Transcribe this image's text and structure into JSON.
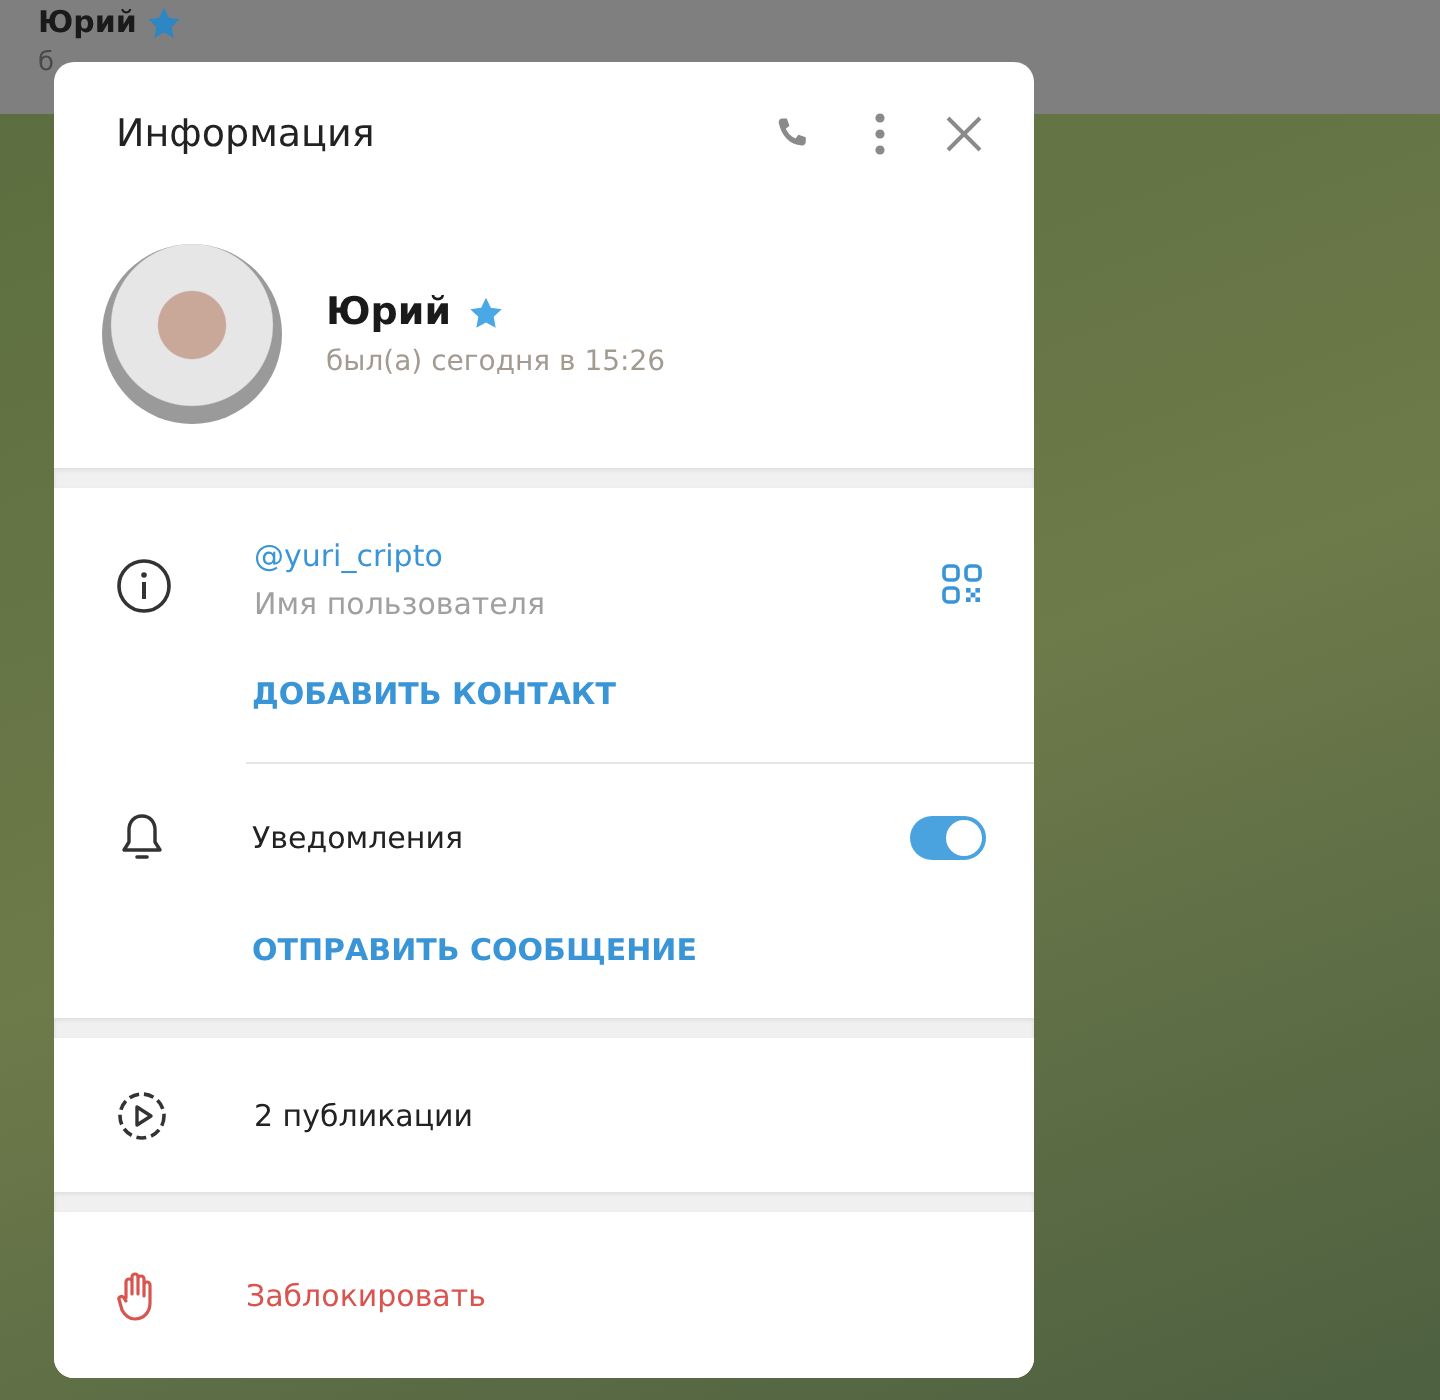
{
  "chat_header": {
    "name": "Юрий",
    "premium": true,
    "status": "б"
  },
  "dialog": {
    "title": "Информация",
    "profile": {
      "name": "Юрий",
      "premium": true,
      "last_seen": "был(а) сегодня в 15:26"
    },
    "username": {
      "value": "@yuri_cripto",
      "label": "Имя пользователя"
    },
    "add_contact": "ДОБАВИТЬ КОНТАКТ",
    "notifications": {
      "label": "Уведомления",
      "on": true
    },
    "send_message": "ОТПРАВИТЬ СООБЩЕНИЕ",
    "stories": "2 публикации",
    "block": "Заблокировать"
  }
}
